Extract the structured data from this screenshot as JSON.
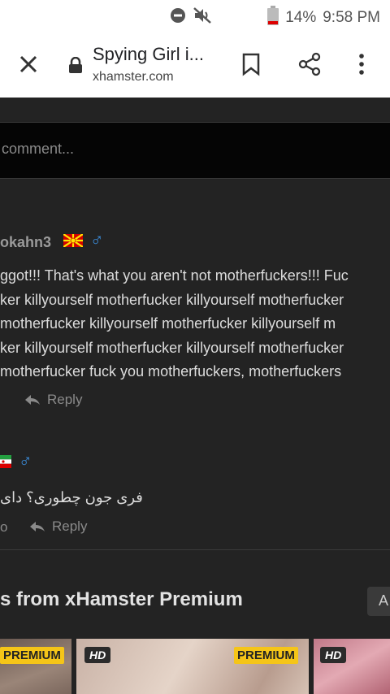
{
  "status_bar": {
    "battery": "14%",
    "time": "9:58 PM"
  },
  "toolbar": {
    "title": "Spying Girl i...",
    "url": "xhamster.com"
  },
  "comment_box": {
    "placeholder": "comment..."
  },
  "comments": [
    {
      "username": "okahn3",
      "lines": [
        "ggot!!!  That's what you aren't not motherfuckers!!!  Fuc",
        "ker killyourself motherfucker killyourself motherfucker",
        " motherfucker killyourself motherfucker killyourself m",
        "ker killyourself motherfucker killyourself motherfucker",
        " motherfucker fuck you motherfuckers, motherfuckers"
      ],
      "reply_label": "Reply"
    },
    {
      "username": "",
      "lines": [
        "فری جون چطوری؟ دای"
      ],
      "meta": "o",
      "reply_label": "Reply"
    }
  ],
  "premium": {
    "title": "s from xHamster Premium",
    "button_label": "A",
    "thumbs": [
      {
        "badge": "PREMIUM"
      },
      {
        "badge": "HD",
        "badge2": "PREMIUM"
      },
      {
        "badge": "HD"
      }
    ]
  }
}
